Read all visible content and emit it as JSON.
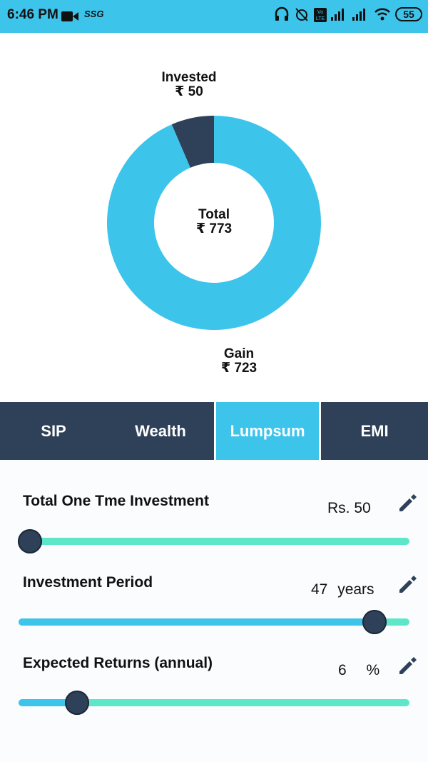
{
  "status_bar": {
    "time": "6:46 PM",
    "carrier": "SSG",
    "battery": "55",
    "icons": [
      "video-camera-icon",
      "headphones-icon",
      "alarm-off-icon",
      "volte-icon",
      "signal-icon",
      "signal-icon",
      "wifi-icon",
      "battery-icon"
    ]
  },
  "chart_data": {
    "type": "pie",
    "style": "donut",
    "slices": [
      {
        "label": "Invested",
        "value": 50,
        "color": "#2f4158"
      },
      {
        "label": "Gain",
        "value": 723,
        "color": "#3dc4ea"
      }
    ],
    "labels": {
      "invested_title": "Invested",
      "invested_value": "₹ 50",
      "total_title": "Total",
      "total_value": "₹ 773",
      "gain_title": "Gain",
      "gain_value": "₹ 723"
    }
  },
  "tabs": [
    {
      "label": "SIP",
      "active": false
    },
    {
      "label": "Wealth",
      "active": false
    },
    {
      "label": "Lumpsum",
      "active": true
    },
    {
      "label": "EMI",
      "active": false
    }
  ],
  "controls": {
    "investment": {
      "title": "Total One Tme Investment",
      "value": "Rs. 50",
      "slider_fraction": 0.03
    },
    "period": {
      "title": "Investment Period",
      "value_number": "47",
      "value_unit": "years",
      "slider_fraction": 0.91
    },
    "returns": {
      "title": "Expected Returns (annual)",
      "value_number": "6",
      "value_unit": "%",
      "slider_fraction": 0.15
    }
  },
  "colors": {
    "accent": "#3dc4ea",
    "dark": "#2f4158",
    "track": "#5de6c7"
  }
}
